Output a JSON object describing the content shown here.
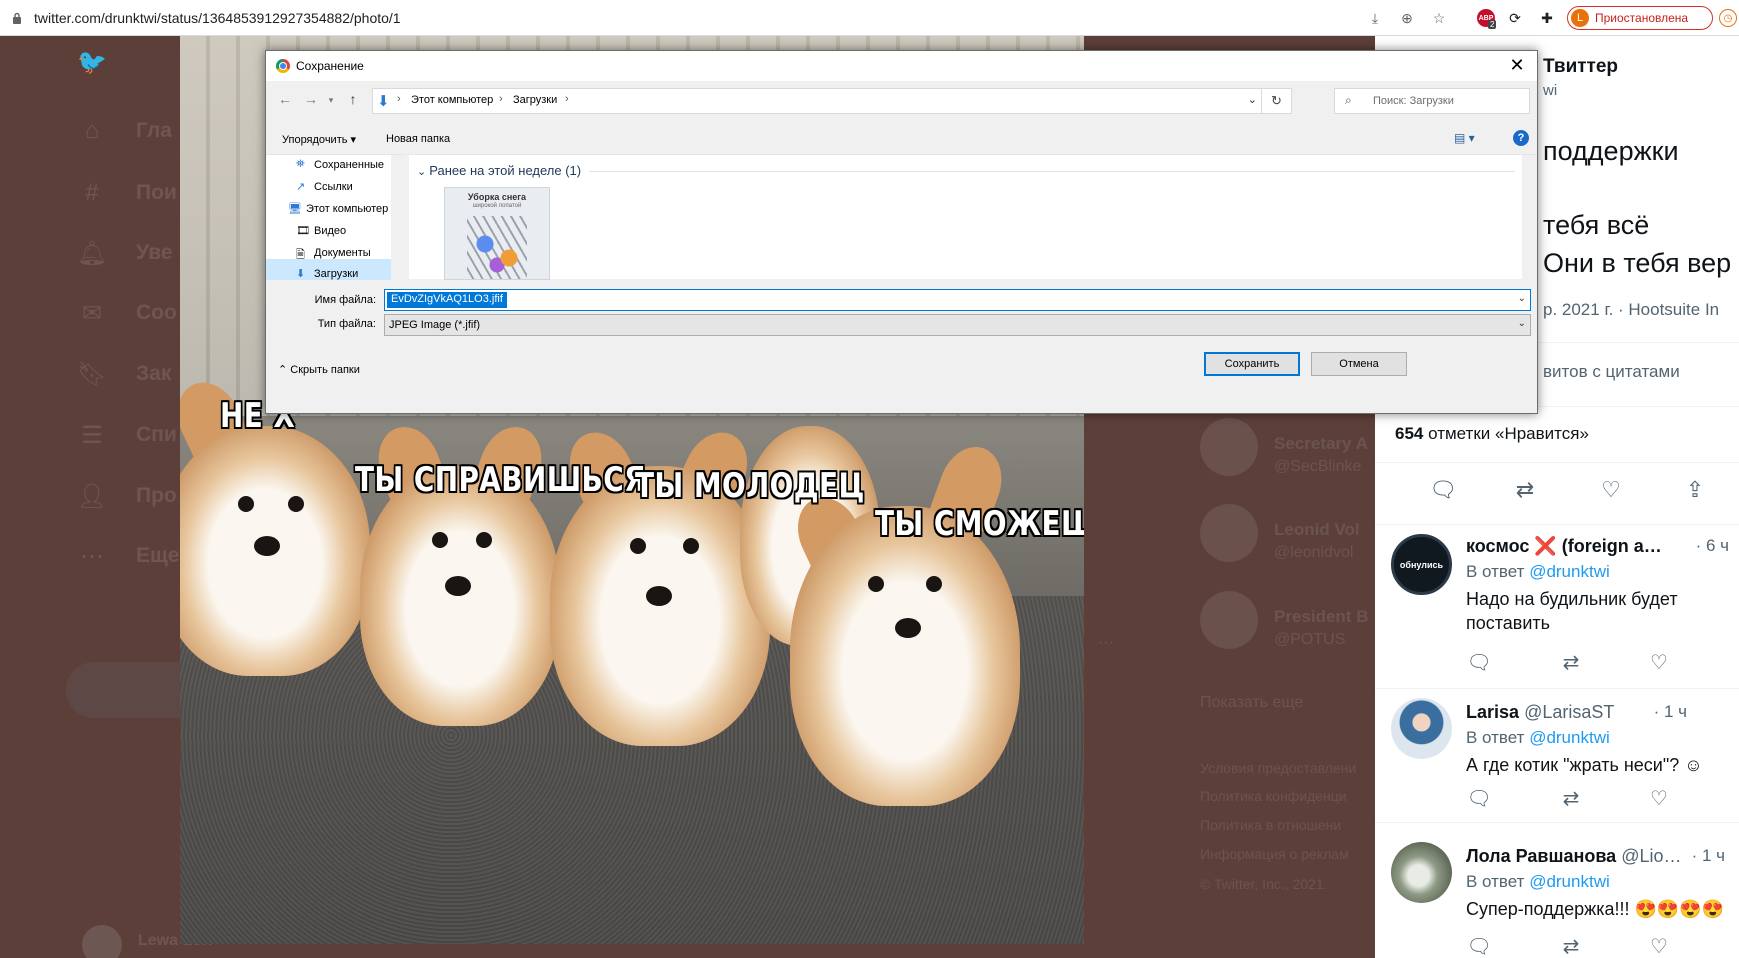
{
  "browser": {
    "url": "twitter.com/drunktwi/status/1364853912927354882/photo/1",
    "profile_initial": "L",
    "profile_status": "Приостановлена",
    "abp_label": "ABP",
    "abp_count": "2"
  },
  "twitter_nav": {
    "items": [
      {
        "icon": "home-icon",
        "label": "Гла"
      },
      {
        "icon": "hashtag-icon",
        "label": "Пои"
      },
      {
        "icon": "bell-icon",
        "label": "Уве"
      },
      {
        "icon": "mail-icon",
        "label": "Соо"
      },
      {
        "icon": "bookmark-icon",
        "label": "Зак"
      },
      {
        "icon": "list-icon",
        "label": "Спи"
      },
      {
        "icon": "profile-icon",
        "label": "Про"
      },
      {
        "icon": "more-icon",
        "label": "Еще"
      }
    ],
    "bottom_user": "Lewa Lew"
  },
  "who_to_follow": [
    {
      "name": "Secretary A",
      "handle": "@SecBlinke"
    },
    {
      "name": "Leonid Vol",
      "handle": "@leonidvol"
    },
    {
      "name": "President B",
      "handle": "@POTUS"
    }
  ],
  "show_more": "Показать еще",
  "footer_links": [
    "Условия предоставлени",
    "Политика конфиденци",
    "Политика в отношени",
    "Информация о реклам",
    "© Twitter, Inc., 2021."
  ],
  "meme": {
    "captions": [
      "НЕ Х",
      "ТЫ СПРАВИШЬСЯ",
      "ТЫ МОЛОДЕЦ",
      "ТЫ СМОЖЕШЬ"
    ]
  },
  "tweet_panel": {
    "header_title": "Твиттер",
    "header_sub": "wi",
    "text_lines": [
      "поддержки",
      "тебя всё",
      "Они в тебя вер"
    ],
    "meta": "р. 2021 г. · Hootsuite In",
    "quotes": "витов с цитатами",
    "likes_count": "654",
    "likes_label": "отметки «Нравится»"
  },
  "replies": [
    {
      "name": "космос ❌ (foreign a…",
      "handle": "",
      "time": "· 6 ч",
      "reply_prefix": "В ответ",
      "reply_to": "@drunktwi",
      "text": "Надо на будильник будет поставить",
      "avatar_color": "#101820",
      "avatar_text": "обнулись"
    },
    {
      "name": "Larisa",
      "handle": "@LarisaST",
      "time": "· 1 ч",
      "reply_prefix": "В ответ",
      "reply_to": "@drunktwi",
      "text": "А где котик \"жрать неси\"? ☺",
      "avatar_color": "#c9d6e4",
      "avatar_text": ""
    },
    {
      "name": "Лола Равшанова",
      "handle": "@Lio…",
      "time": "· 1 ч",
      "reply_prefix": "В ответ",
      "reply_to": "@drunktwi",
      "text": "Супер-поддержка!!! 😍😍😍😍",
      "avatar_color": "#8f9a86",
      "avatar_text": ""
    }
  ],
  "dialog": {
    "title": "Сохранение",
    "breadcrumbs": [
      "Этот компьютер",
      "Загрузки"
    ],
    "search_placeholder": "Поиск: Загрузки",
    "organize": "Упорядочить ▾",
    "new_folder": "Новая папка",
    "tree": [
      "Сохраненные",
      "Ссылки",
      "Этот компьютер",
      "Видео",
      "Документы",
      "Загрузки"
    ],
    "group_label": "Ранее на этой неделе (1)",
    "thumb_title": "Уборка снега",
    "thumb_sub": "широкой лопатой",
    "filename_label": "Имя файла:",
    "filename_value": "EvDvZIgVkAQ1LO3.jfif",
    "filetype_label": "Тип файла:",
    "filetype_value": "JPEG Image (*.jfif)",
    "hide_folders": "Скрыть папки",
    "save_button": "Сохранить",
    "cancel_button": "Отмена"
  }
}
